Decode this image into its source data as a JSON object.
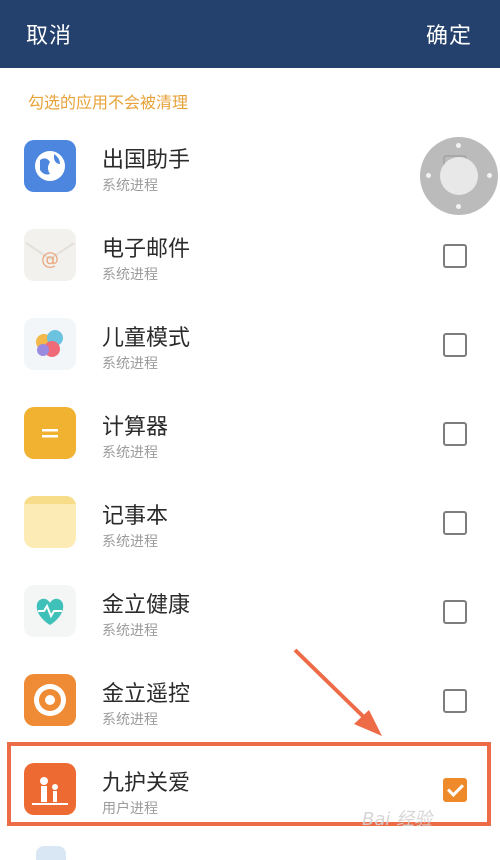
{
  "header": {
    "cancel_label": "取消",
    "confirm_label": "确定"
  },
  "section_title": "勾选的应用不会被清理",
  "apps": [
    {
      "name": "出国助手",
      "type": "系统进程",
      "icon": "globe-icon",
      "checked": false
    },
    {
      "name": "电子邮件",
      "type": "系统进程",
      "icon": "email-icon",
      "checked": false
    },
    {
      "name": "儿童模式",
      "type": "系统进程",
      "icon": "balloons-icon",
      "checked": false
    },
    {
      "name": "计算器",
      "type": "系统进程",
      "icon": "calculator-icon",
      "checked": false
    },
    {
      "name": "记事本",
      "type": "系统进程",
      "icon": "notepad-icon",
      "checked": false
    },
    {
      "name": "金立健康",
      "type": "系统进程",
      "icon": "health-heart-icon",
      "checked": false
    },
    {
      "name": "金立遥控",
      "type": "系统进程",
      "icon": "remote-control-icon",
      "checked": false
    },
    {
      "name": "九护关爱",
      "type": "用户进程",
      "icon": "family-care-icon",
      "checked": true
    }
  ],
  "watermark": "Bai 经验",
  "colors": {
    "header": "#24416d",
    "section_title": "#e7a23a",
    "checkbox_checked": "#ef8a2a",
    "highlight": "#ee6b47"
  }
}
